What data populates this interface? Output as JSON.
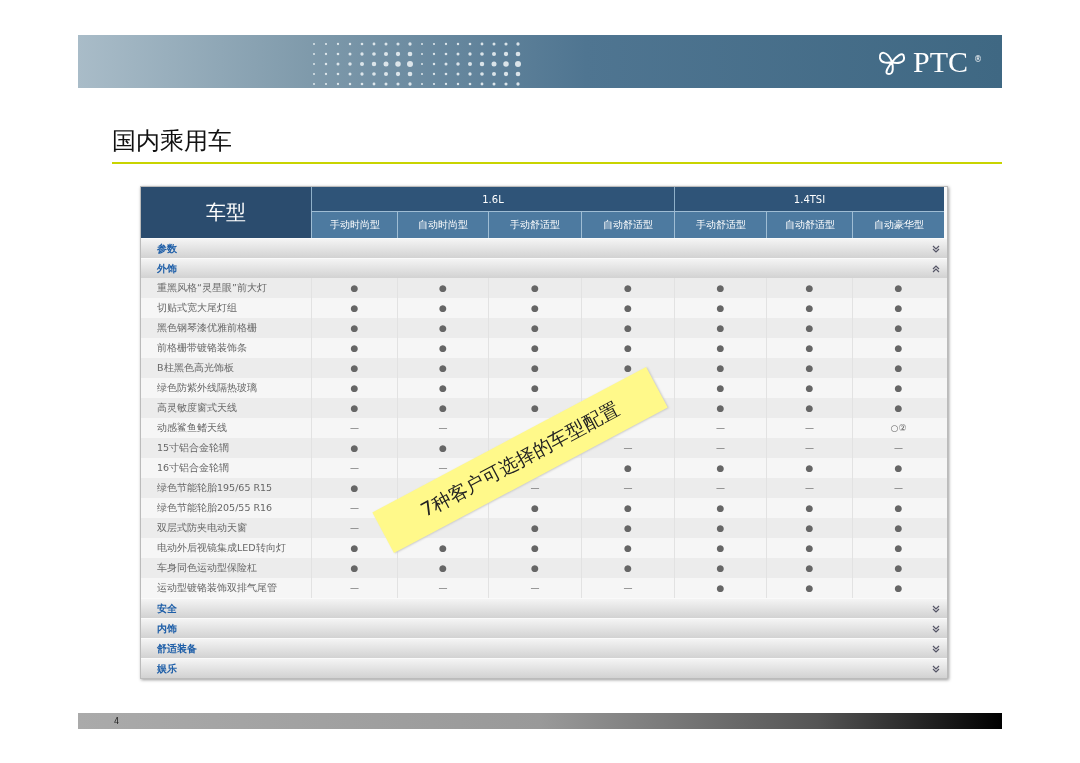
{
  "header": {
    "logo": "PTC",
    "logo_mark": "®"
  },
  "title": "国内乘用车",
  "table": {
    "corner": "车型",
    "groups": [
      {
        "label": "1.6L",
        "columns": [
          "手动时尚型",
          "自动时尚型",
          "手动舒适型",
          "自动舒适型"
        ]
      },
      {
        "label": "1.4TSI",
        "columns": [
          "手动舒适型",
          "自动舒适型",
          "自动豪华型"
        ]
      }
    ],
    "sections": [
      {
        "title": "参数",
        "expanded": false
      },
      {
        "title": "外饰",
        "expanded": true,
        "rows": [
          {
            "label": "重黑风格“灵星眼”前大灯",
            "cells": [
              "●",
              "●",
              "●",
              "●",
              "●",
              "●",
              "●"
            ]
          },
          {
            "label": "切贴式宽大尾灯组",
            "cells": [
              "●",
              "●",
              "●",
              "●",
              "●",
              "●",
              "●"
            ]
          },
          {
            "label": "黑色钢琴漆优雅前格栅",
            "cells": [
              "●",
              "●",
              "●",
              "●",
              "●",
              "●",
              "●"
            ]
          },
          {
            "label": "前格栅带镀铬装饰条",
            "cells": [
              "●",
              "●",
              "●",
              "●",
              "●",
              "●",
              "●"
            ]
          },
          {
            "label": "B柱黑色高光饰板",
            "cells": [
              "●",
              "●",
              "●",
              "●",
              "●",
              "●",
              "●"
            ]
          },
          {
            "label": "绿色防紫外线隔热玻璃",
            "cells": [
              "●",
              "●",
              "●",
              null,
              "●",
              "●",
              "●"
            ]
          },
          {
            "label": "高灵敏度窗式天线",
            "cells": [
              "●",
              "●",
              "●",
              null,
              "●",
              "●",
              "●"
            ]
          },
          {
            "label": "动感鲨鱼鳍天线",
            "cells": [
              "—",
              "—",
              null,
              null,
              "—",
              "—",
              "○②"
            ]
          },
          {
            "label": "15寸铝合金轮辋",
            "cells": [
              "●",
              "●",
              null,
              "—",
              "—",
              "—",
              "—"
            ]
          },
          {
            "label": "16寸铝合金轮辋",
            "cells": [
              "—",
              "—",
              null,
              "●",
              "●",
              "●",
              "●"
            ]
          },
          {
            "label": "绿色节能轮胎195/65  R15",
            "cells": [
              "●",
              null,
              "—",
              "—",
              "—",
              "—",
              "—"
            ]
          },
          {
            "label": "绿色节能轮胎205/55  R16",
            "cells": [
              "—",
              null,
              "●",
              "●",
              "●",
              "●",
              "●"
            ]
          },
          {
            "label": "双层式防夹电动天窗",
            "cells": [
              "—",
              null,
              "●",
              "●",
              "●",
              "●",
              "●"
            ]
          },
          {
            "label": "电动外后视镜集成LED转向灯",
            "cells": [
              "●",
              "●",
              "●",
              "●",
              "●",
              "●",
              "●"
            ]
          },
          {
            "label": "车身同色运动型保险杠",
            "cells": [
              "●",
              "●",
              "●",
              "●",
              "●",
              "●",
              "●"
            ]
          },
          {
            "label": "运动型镀铬装饰双排气尾管",
            "cells": [
              "—",
              "—",
              "—",
              "—",
              "●",
              "●",
              "●"
            ]
          }
        ]
      },
      {
        "title": "安全",
        "expanded": false
      },
      {
        "title": "内饰",
        "expanded": false
      },
      {
        "title": "舒适装备",
        "expanded": false
      },
      {
        "title": "娱乐",
        "expanded": false
      }
    ]
  },
  "sticker": "7种客户可选择的车型配置",
  "page_number": "4"
}
